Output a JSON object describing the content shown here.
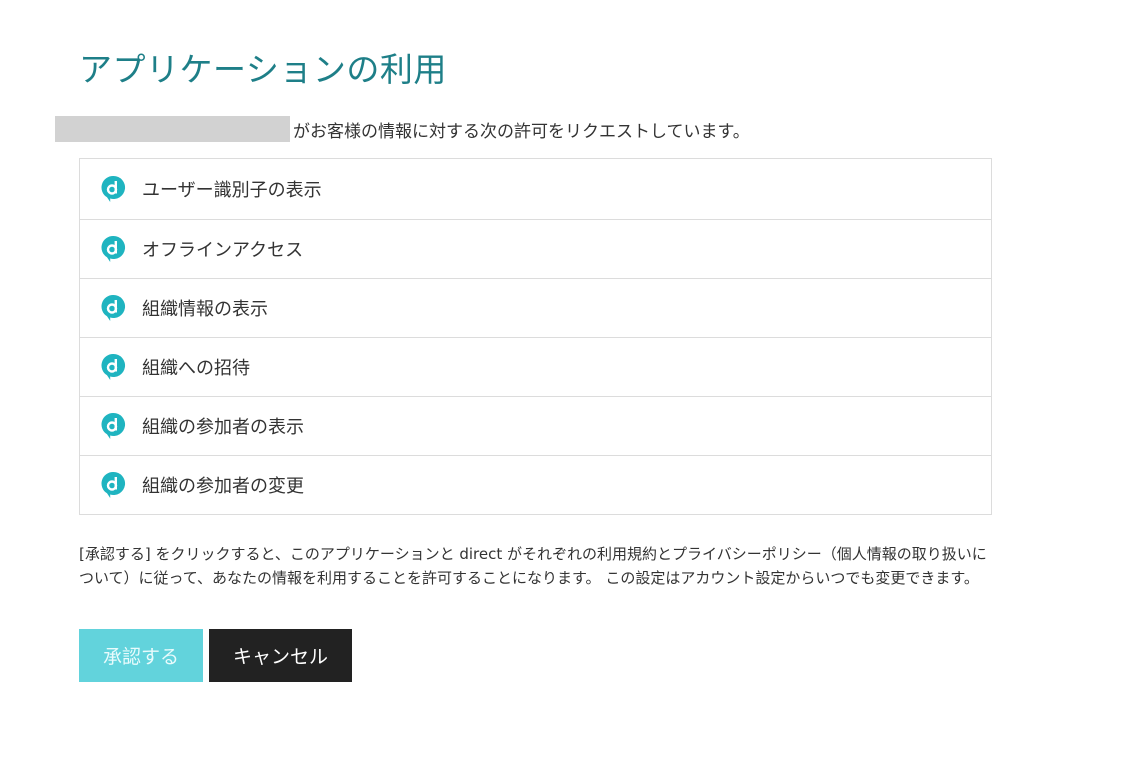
{
  "page": {
    "title": "アプリケーションの利用",
    "request_text": "がお客様の情報に対する次の許可をリクエストしています。"
  },
  "permissions": [
    {
      "label": "ユーザー識別子の表示",
      "icon": "direct-logo-icon"
    },
    {
      "label": "オフラインアクセス",
      "icon": "direct-logo-icon"
    },
    {
      "label": "組織情報の表示",
      "icon": "direct-logo-icon"
    },
    {
      "label": "組織への招待",
      "icon": "direct-logo-icon"
    },
    {
      "label": "組織の参加者の表示",
      "icon": "direct-logo-icon"
    },
    {
      "label": "組織の参加者の変更",
      "icon": "direct-logo-icon"
    }
  ],
  "consent": {
    "text": "[承認する] をクリックすると、このアプリケーションと direct がそれぞれの利用規約とプライバシーポリシー（個人情報の取り扱いについて）に従って、あなたの情報を利用することを許可することになります。 この設定はアカウント設定からいつでも変更できます。"
  },
  "actions": {
    "approve_label": "承認する",
    "cancel_label": "キャンセル"
  },
  "colors": {
    "title": "#1e7f88",
    "icon": "#1fb4c0",
    "approve_button": "#62d3dc",
    "cancel_button": "#222222",
    "redaction": "#d2d2d2"
  }
}
